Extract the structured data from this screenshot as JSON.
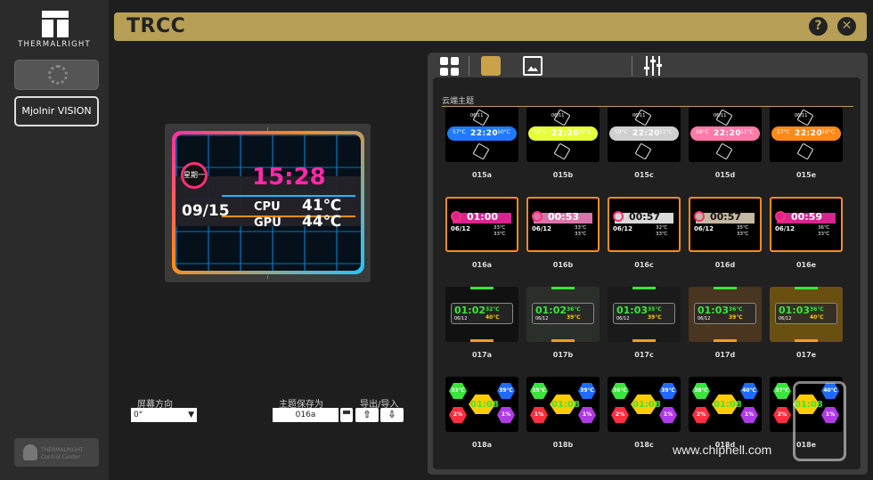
{
  "brand": {
    "name": "THERMALRIGHT",
    "footer_line1": "THERMALRIGHT",
    "footer_line2": "Control Center"
  },
  "sidebar": {
    "device": "Mjolnir VISION"
  },
  "header": {
    "title": "TRCC",
    "help": "?",
    "close": "✕"
  },
  "preview": {
    "day": "星期一",
    "time": "15:28",
    "date": "09/15",
    "cpu_label": "CPU",
    "cpu_val": "41℃",
    "gpu_label": "GPU",
    "gpu_val": "44℃"
  },
  "controls": {
    "orientation_label": "屏幕方向",
    "orientation_value": "0°",
    "save_label": "主题保存为",
    "theme_name": "016a",
    "io_label": "导出/导入",
    "export_icon": "upload-icon",
    "import_icon": "download-icon"
  },
  "gallery": {
    "section": "云端主题",
    "themes": [
      {
        "id": "015a",
        "time": "22:20",
        "color": "#1e7bff",
        "date": "06/11",
        "cpu": "57°C",
        "gpu": "50°C"
      },
      {
        "id": "015b",
        "time": "22:20",
        "color": "#e6ff3a",
        "date": "06/11",
        "cpu": "58°C",
        "gpu": "50°C"
      },
      {
        "id": "015c",
        "time": "22:20",
        "color": "#cfcfcf",
        "date": "06/11",
        "cpu": "59°C",
        "gpu": "51°C"
      },
      {
        "id": "015d",
        "time": "22:20",
        "color": "#ff7aa8",
        "date": "06/11",
        "cpu": "58°C",
        "gpu": "51°C"
      },
      {
        "id": "015e",
        "time": "22:20",
        "color": "#ff8a1a",
        "date": "06/11",
        "cpu": "57°C",
        "gpu": "50°C"
      },
      {
        "id": "016a",
        "time": "01:00",
        "color": "#ff2aa8",
        "date": "06/12",
        "cpu": "33℃",
        "gpu": "33℃"
      },
      {
        "id": "016b",
        "time": "00:53",
        "color": "#ff8ac8",
        "date": "06/12",
        "cpu": "33℃",
        "gpu": "33℃"
      },
      {
        "id": "016c",
        "time": "00:57",
        "color": "#ffffff",
        "date": "06/12",
        "cpu": "32℃",
        "gpu": "33℃"
      },
      {
        "id": "016d",
        "time": "00:57",
        "color": "#e8d8c0",
        "date": "06/12",
        "cpu": "35℃",
        "gpu": "33℃"
      },
      {
        "id": "016e",
        "time": "00:59",
        "color": "#ff2aa8",
        "date": "06/12",
        "cpu": "36℃",
        "gpu": "33℃"
      },
      {
        "id": "017a",
        "time": "01:02",
        "color": "#39e639",
        "date": "06/12",
        "cpu": "32℃",
        "gpu": "40℃"
      },
      {
        "id": "017b",
        "time": "01:02",
        "color": "#39e639",
        "date": "06/12",
        "cpu": "36℃",
        "gpu": "39℃"
      },
      {
        "id": "017c",
        "time": "01:03",
        "color": "#39e639",
        "date": "06/12",
        "cpu": "35℃",
        "gpu": "39℃"
      },
      {
        "id": "017d",
        "time": "01:03",
        "color": "#39e639",
        "date": "06/12",
        "cpu": "36℃",
        "gpu": "39℃"
      },
      {
        "id": "017e",
        "time": "01:03",
        "color": "#39e639",
        "date": "06/12",
        "cpu": "36℃",
        "gpu": "40℃"
      },
      {
        "id": "018a",
        "time": "01:08",
        "color": "#39e639",
        "cpu": "33℃",
        "gpu": "39℃",
        "cpu2": "2%",
        "gpu2": "1%"
      },
      {
        "id": "018b",
        "time": "01:08",
        "color": "#39e639",
        "cpu": "35℃",
        "gpu": "39℃",
        "cpu2": "1%",
        "gpu2": "1%"
      },
      {
        "id": "018c",
        "time": "01:08",
        "color": "#39e639",
        "cpu": "36℃",
        "gpu": "39℃",
        "cpu2": "2%",
        "gpu2": "1%"
      },
      {
        "id": "018d",
        "time": "01:08",
        "color": "#39e639",
        "cpu": "38℃",
        "gpu": "40℃",
        "cpu2": "2%",
        "gpu2": "1%"
      },
      {
        "id": "018e",
        "time": "01:08",
        "color": "#39e639",
        "cpu": "37℃",
        "gpu": "40℃",
        "cpu2": "2%",
        "gpu2": "1%"
      }
    ]
  },
  "watermark": "www.chiphell.com"
}
